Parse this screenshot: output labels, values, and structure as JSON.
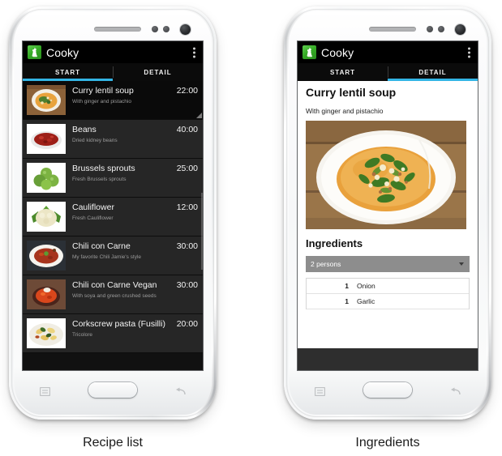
{
  "app": {
    "name": "Cooky",
    "icon": "cooky-app-icon",
    "accent_color": "#33b5e5",
    "brand_green": "#34a924"
  },
  "captions": {
    "left": "Recipe list",
    "right": "Ingredients"
  },
  "device": {
    "hardware": {
      "speaker": "speaker-grille",
      "camera": "front-camera",
      "home": "home-button",
      "menu": "menu-soft-key",
      "back": "back-soft-key"
    }
  },
  "left_phone": {
    "action_bar": {
      "title": "Cooky",
      "overflow": "overflow-menu"
    },
    "tabs": {
      "items": [
        {
          "label": "START",
          "selected": true
        },
        {
          "label": "DETAIL",
          "selected": false
        }
      ],
      "active_index": 0
    },
    "recipes": [
      {
        "title": "Curry lentil soup",
        "subtitle": "With ginger and pistachio",
        "time": "22:00",
        "image": "curry-lentil-soup-thumb",
        "selected": true
      },
      {
        "title": "Beans",
        "subtitle": "Dried kidney beans",
        "time": "40:00",
        "image": "beans-thumb",
        "selected": false
      },
      {
        "title": "Brussels sprouts",
        "subtitle": "Fresh Brussels sprouts",
        "time": "25:00",
        "image": "brussels-sprouts-thumb",
        "selected": false
      },
      {
        "title": "Cauliflower",
        "subtitle": "Fresh Cauliflower",
        "time": "12:00",
        "image": "cauliflower-thumb",
        "selected": false
      },
      {
        "title": "Chili con Carne",
        "subtitle": "My favorite Chili Jamie's style",
        "time": "30:00",
        "image": "chili-con-carne-thumb",
        "selected": false
      },
      {
        "title": "Chili con Carne Vegan",
        "subtitle": "With soya and green crushed seeds",
        "time": "30:00",
        "image": "chili-vegan-thumb",
        "selected": false
      },
      {
        "title": "Corkscrew pasta (Fusilli)",
        "subtitle": "Tricolore",
        "time": "20:00",
        "image": "fusilli-thumb",
        "selected": false
      }
    ]
  },
  "right_phone": {
    "action_bar": {
      "title": "Cooky",
      "overflow": "overflow-menu"
    },
    "tabs": {
      "items": [
        {
          "label": "START",
          "selected": false
        },
        {
          "label": "DETAIL",
          "selected": true
        }
      ],
      "active_index": 1
    },
    "detail": {
      "title": "Curry lentil soup",
      "subtitle": "With ginger and pistachio",
      "photo": "curry-lentil-soup-photo",
      "section_title": "Ingredients",
      "servings_selected": "2 persons",
      "ingredients": [
        {
          "qty": "1",
          "name": "Onion"
        },
        {
          "qty": "1",
          "name": "Garlic"
        }
      ]
    }
  }
}
